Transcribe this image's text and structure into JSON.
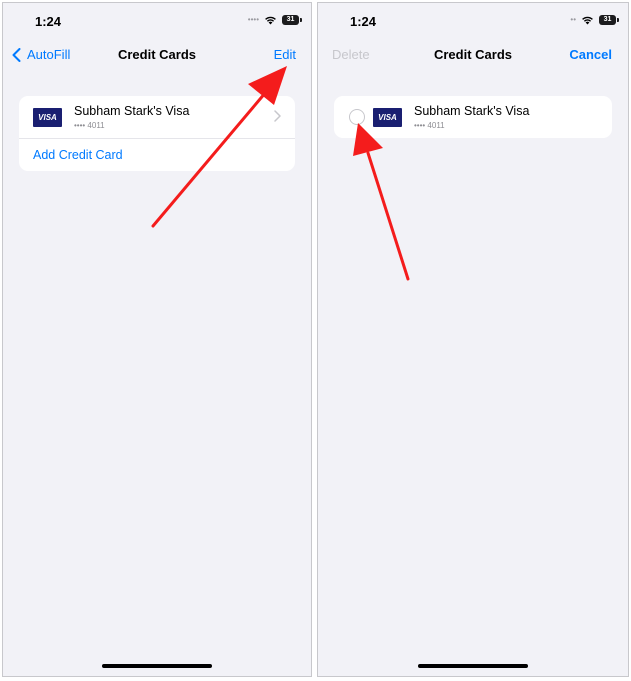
{
  "left_screen": {
    "status": {
      "time": "1:24",
      "battery": "31"
    },
    "nav": {
      "back_label": "AutoFill",
      "title": "Credit Cards",
      "edit_label": "Edit"
    },
    "card": {
      "logo": "VISA",
      "name": "Subham Stark's Visa",
      "number": "•••• 4011"
    },
    "add_card_label": "Add Credit Card"
  },
  "right_screen": {
    "status": {
      "time": "1:24",
      "battery": "31"
    },
    "nav": {
      "delete_label": "Delete",
      "title": "Credit Cards",
      "cancel_label": "Cancel"
    },
    "card": {
      "logo": "VISA",
      "name": "Subham Stark's Visa",
      "number": "•••• 4011"
    }
  },
  "colors": {
    "accent": "#007aff",
    "annotation_arrow": "#f41c1c",
    "background": "#f2f2f7",
    "visa_blue": "#1a1f71",
    "disabled": "#c7c7cc"
  },
  "icons": [
    "back-chevron-icon",
    "wifi-icon",
    "battery-icon",
    "signal-dots-icon",
    "disclosure-chevron-icon",
    "selection-circle-icon",
    "annotation-arrow-icon"
  ]
}
